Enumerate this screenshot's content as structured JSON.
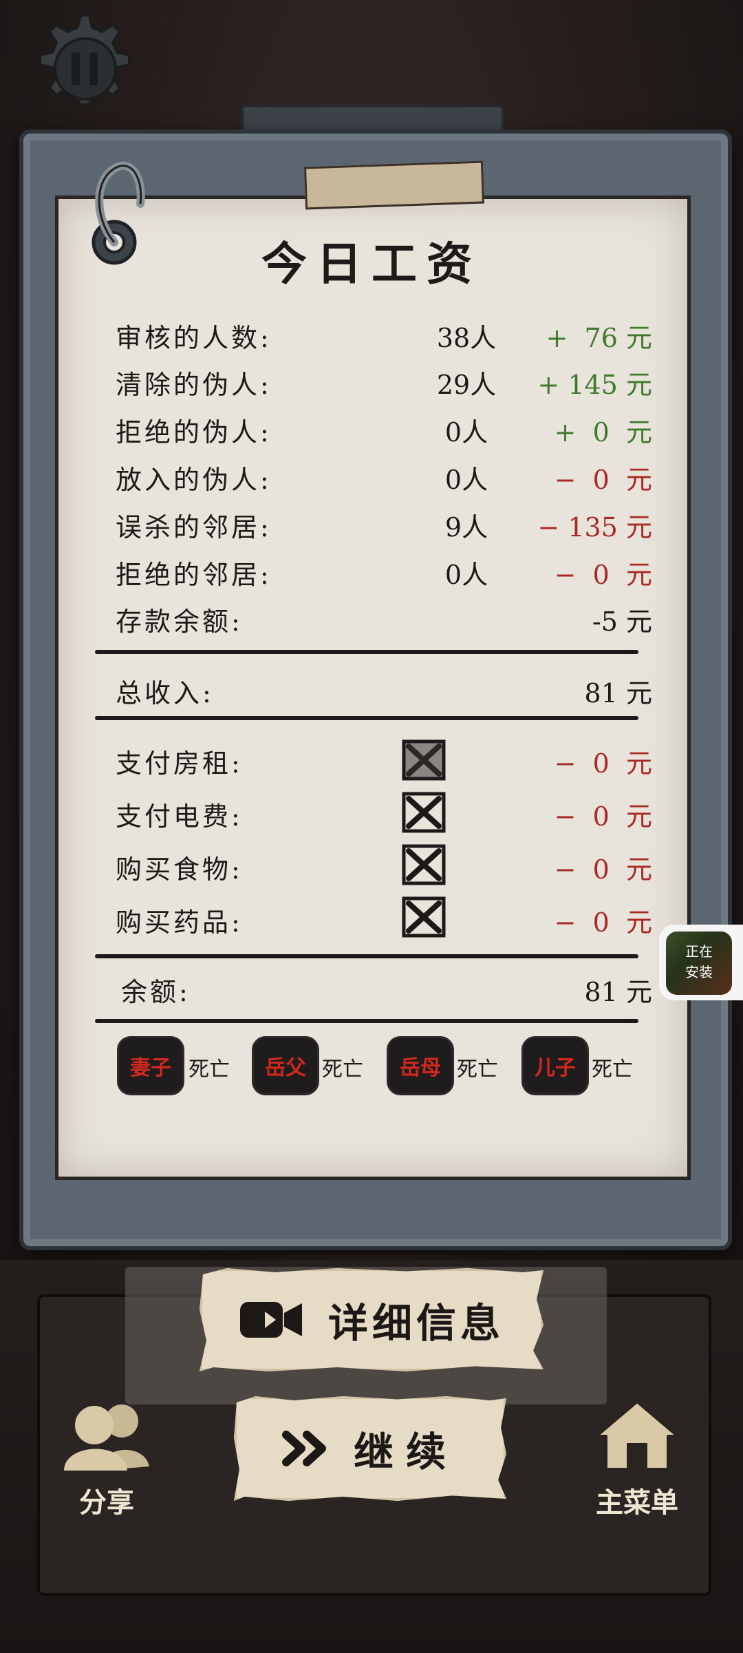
{
  "title": "今日工资",
  "stats": [
    {
      "label": "审核的人数:",
      "count": "38人",
      "sign": "+",
      "value": "76",
      "unit": "元",
      "tone": "pos"
    },
    {
      "label": "清除的伪人:",
      "count": "29人",
      "sign": "+",
      "value": "145",
      "unit": "元",
      "tone": "pos"
    },
    {
      "label": "拒绝的伪人:",
      "count": "0人",
      "sign": "+",
      "value": "0",
      "unit": "元",
      "tone": "pos"
    },
    {
      "label": "放入的伪人:",
      "count": "0人",
      "sign": "−",
      "value": "0",
      "unit": "元",
      "tone": "neg"
    },
    {
      "label": "误杀的邻居:",
      "count": "9人",
      "sign": "−",
      "value": "135",
      "unit": "元",
      "tone": "neg"
    },
    {
      "label": "拒绝的邻居:",
      "count": "0人",
      "sign": "−",
      "value": "0",
      "unit": "元",
      "tone": "neg"
    }
  ],
  "savings": {
    "label": "存款余额:",
    "value": "-5",
    "unit": "元"
  },
  "total_income": {
    "label": "总收入:",
    "value": "81",
    "unit": "元"
  },
  "expenses": [
    {
      "label": "支付房租:",
      "checked": false,
      "sign": "−",
      "value": "0",
      "unit": "元"
    },
    {
      "label": "支付电费:",
      "checked": false,
      "sign": "−",
      "value": "0",
      "unit": "元"
    },
    {
      "label": "购买食物:",
      "checked": false,
      "sign": "−",
      "value": "0",
      "unit": "元"
    },
    {
      "label": "购买药品:",
      "checked": false,
      "sign": "−",
      "value": "0",
      "unit": "元"
    }
  ],
  "balance": {
    "label": "余额:",
    "value": "81",
    "unit": "元"
  },
  "family": [
    {
      "name": "妻子",
      "status": "死亡"
    },
    {
      "name": "岳父",
      "status": "死亡"
    },
    {
      "name": "岳母",
      "status": "死亡"
    },
    {
      "name": "儿子",
      "status": "死亡"
    }
  ],
  "installing_badge": {
    "line1": "正在",
    "line2": "安装"
  },
  "buttons": {
    "details": "详细信息",
    "continue": "继续",
    "share": "分享",
    "main_menu": "主菜单"
  },
  "colors": {
    "positive": "#3f7a2c",
    "negative": "#a82a22",
    "paper": "#e8e4dc",
    "clipboard": "#5c6670"
  },
  "icons": [
    "pause-icon",
    "video-camera-icon",
    "fast-forward-icon",
    "share-people-icon",
    "home-icon",
    "close-x-icon"
  ]
}
